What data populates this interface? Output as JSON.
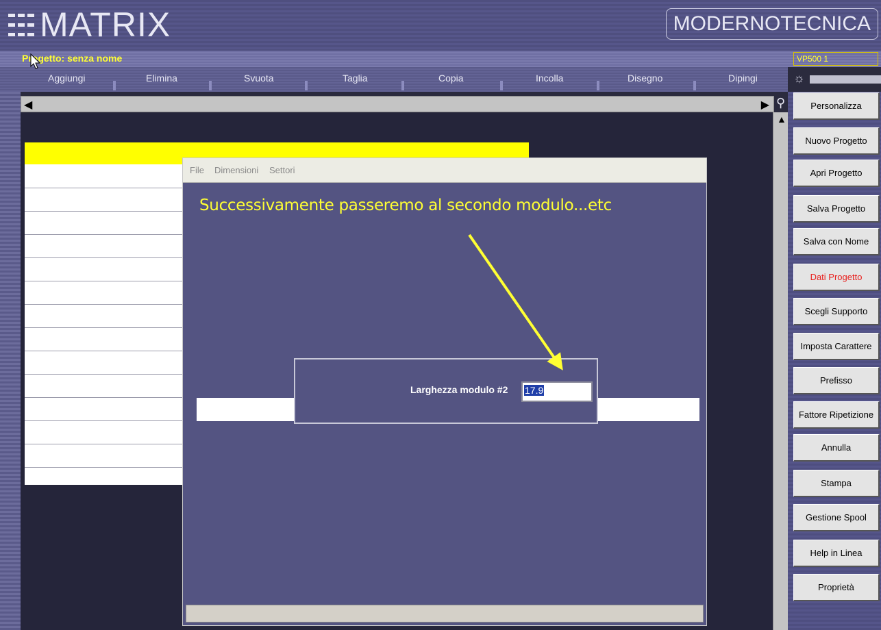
{
  "app": {
    "logo_text": "MATRIX",
    "brand": "MODERNOTECNICA",
    "project_name": "Progetto: senza nome",
    "version": "VP500 1"
  },
  "menu": {
    "items": [
      "Aggiungi",
      "Elimina",
      "Svuota",
      "Taglia",
      "Copia",
      "Incolla",
      "Disegno",
      "Dipingi"
    ]
  },
  "dialog": {
    "menus": [
      "File",
      "Dimensioni",
      "Settori"
    ],
    "annotation": "Successivamente passeremo al secondo modulo...etc",
    "module_label": "Larghezza modulo #2",
    "module_value": "17.9"
  },
  "sidebar": {
    "buttons": [
      "Personalizza",
      "Nuovo Progetto",
      "Apri Progetto",
      "Salva Progetto",
      "Salva con Nome",
      "Dati Progetto",
      "Scegli Supporto",
      "Imposta Carattere",
      "Prefisso",
      "Fattore Ripetizione",
      "Annulla",
      "Stampa",
      "Gestione Spool",
      "Help in Linea",
      "Proprietà"
    ],
    "active_button": "Dati Progetto"
  },
  "icons": {
    "scroll_left": "arrow-left-icon",
    "scroll_right": "arrow-right-icon",
    "scroll_up": "arrow-up-icon",
    "zoom": "magnifier-icon",
    "brightness": "sun-icon",
    "cursor": "mouse-pointer-icon"
  },
  "colors": {
    "accent_yellow": "#ffff33",
    "background_purple": "#545482",
    "active_red": "#e8201e"
  }
}
